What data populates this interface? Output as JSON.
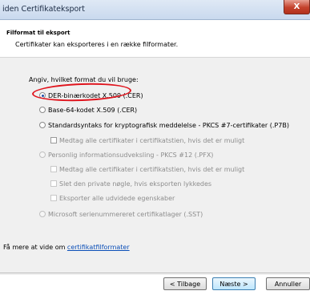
{
  "window": {
    "title": "iden Certifikateksport",
    "close_label": "X"
  },
  "header": {
    "section_title": "Filformat til eksport",
    "description": "Certifikater kan eksporteres i en række filformater."
  },
  "format_prompt": "Angiv, hvilket format du vil bruge:",
  "options": [
    {
      "label": "DER-binærkodet X.509 (.CER)",
      "selected": true,
      "enabled": true
    },
    {
      "label": "Base-64-kodet X.509 (.CER)",
      "selected": false,
      "enabled": true
    },
    {
      "label": "Standardsyntaks for kryptografisk meddelelse - PKCS #7-certifikater (.P7B)",
      "selected": false,
      "enabled": true
    },
    {
      "label": "Personlig informationsudveksling - PKCS #12 (.PFX)",
      "selected": false,
      "enabled": false
    },
    {
      "label": "Microsoft serienummereret certifikatlager (.SST)",
      "selected": false,
      "enabled": false
    }
  ],
  "checkboxes": {
    "p7b_include_all": "Medtag alle certifikater i certifikatstien, hvis det er muligt",
    "pfx_include_all": "Medtag alle certifikater i certifikatstien, hvis det er muligt",
    "pfx_delete_key": "Slet den private nøgle, hvis eksporten lykkedes",
    "pfx_export_props": "Eksporter alle udvidede egenskaber"
  },
  "learn_more": {
    "prefix": "Få mere at vide om ",
    "link": "certifikatfilformater"
  },
  "buttons": {
    "back": "< Tilbage",
    "next": "Næste >",
    "cancel": "Annuller"
  }
}
